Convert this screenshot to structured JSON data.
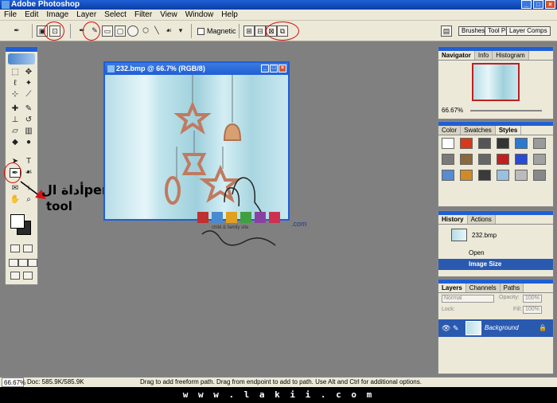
{
  "app": {
    "title": "Adobe Photoshop"
  },
  "menu": [
    "File",
    "Edit",
    "Image",
    "Layer",
    "Select",
    "Filter",
    "View",
    "Window",
    "Help"
  ],
  "options": {
    "magnetic_label": "Magnetic",
    "palette_wells": [
      "Brushes",
      "Tool Pr",
      "Layer Comps"
    ]
  },
  "document": {
    "title": "232.bmp @ 66.7% (RGB/8)"
  },
  "annotation": {
    "line1": "أداة الpen",
    "line2": "tool"
  },
  "watermark": {
    "brand": "LAKII",
    "sub": "child & family site",
    "suffix": ".com",
    "signature": "Sara79"
  },
  "navigator": {
    "tabs": [
      "Navigator",
      "Info",
      "Histogram"
    ],
    "zoom": "66.67%"
  },
  "styles": {
    "tabs": [
      "Color",
      "Swatches",
      "Styles"
    ],
    "swatch_colors": [
      "#ffffff",
      "#d63a1a",
      "#555555",
      "#333333",
      "#2a7ad0",
      "#9a9a9a",
      "#7a7a7a",
      "#8a6a3a",
      "#666666",
      "#c02020",
      "#2a4ad0",
      "#a0a0a0",
      "#5a8ad0",
      "#d08a2a",
      "#3a3a3a",
      "#9ac0e0",
      "#bbbbbb",
      "#888888"
    ]
  },
  "history": {
    "tabs": [
      "History",
      "Actions"
    ],
    "snapshot": "232.bmp",
    "items": [
      "Open",
      "Image Size"
    ]
  },
  "layers": {
    "tabs": [
      "Layers",
      "Channels",
      "Paths"
    ],
    "blend_mode": "Normal",
    "opacity_label": "Opacity:",
    "opacity": "100%",
    "lock_label": "Lock:",
    "fill_label": "Fill:",
    "fill": "100%",
    "layer_name": "Background"
  },
  "status": {
    "zoom": "66.67%",
    "doc": "Doc: 585.9K/585.9K",
    "hint": "Drag to add freeform path.  Drag from endpoint to add to path.  Use Alt and Ctrl for additional options."
  },
  "footer": {
    "url": "w w w . l a k i i . c o m"
  }
}
